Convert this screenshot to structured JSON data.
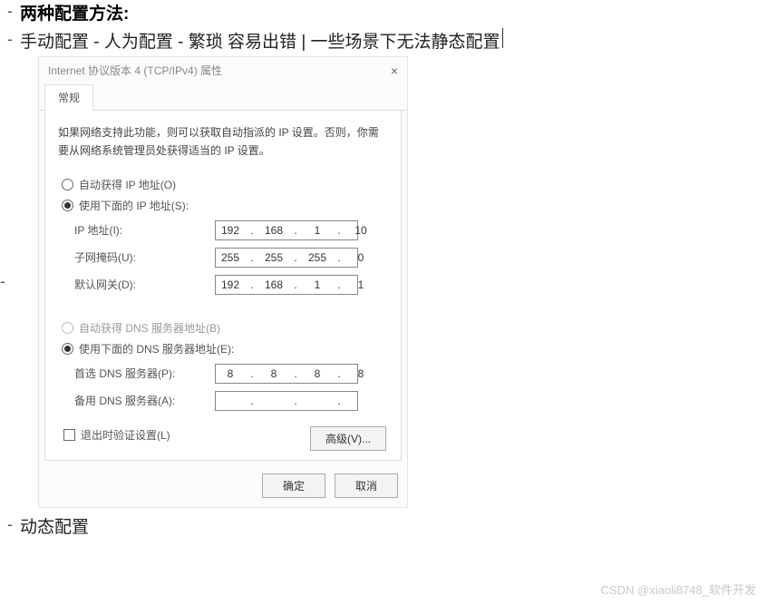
{
  "lines": {
    "heading": "两种配置方法:",
    "sub": "手动配置 - 人为配置 - 繁琐 容易出错 | 一些场景下无法静态配置",
    "bottom": "动态配置"
  },
  "dialog": {
    "title": "Internet 协议版本 4 (TCP/IPv4) 属性",
    "tab": "常规",
    "desc": "如果网络支持此功能，则可以获取自动指派的 IP 设置。否则，你需要从网络系统管理员处获得适当的 IP 设置。",
    "radio_auto_ip": "自动获得 IP 地址(O)",
    "radio_manual_ip": "使用下面的 IP 地址(S):",
    "ip_label": "IP 地址(I):",
    "ip_value": [
      "192",
      "168",
      "1",
      "10"
    ],
    "mask_label": "子网掩码(U):",
    "mask_value": [
      "255",
      "255",
      "255",
      "0"
    ],
    "gw_label": "默认网关(D):",
    "gw_value": [
      "192",
      "168",
      "1",
      "1"
    ],
    "radio_auto_dns": "自动获得 DNS 服务器地址(B)",
    "radio_manual_dns": "使用下面的 DNS 服务器地址(E):",
    "dns1_label": "首选 DNS 服务器(P):",
    "dns1_value": [
      "8",
      "8",
      "8",
      "8"
    ],
    "dns2_label": "备用 DNS 服务器(A):",
    "dns2_value": [
      "",
      "",
      "",
      ""
    ],
    "check_exit": "退出时验证设置(L)",
    "btn_adv": "高级(V)...",
    "btn_ok": "确定",
    "btn_cancel": "取消"
  },
  "watermark": "CSDN @xiaoli8748_软件开发"
}
